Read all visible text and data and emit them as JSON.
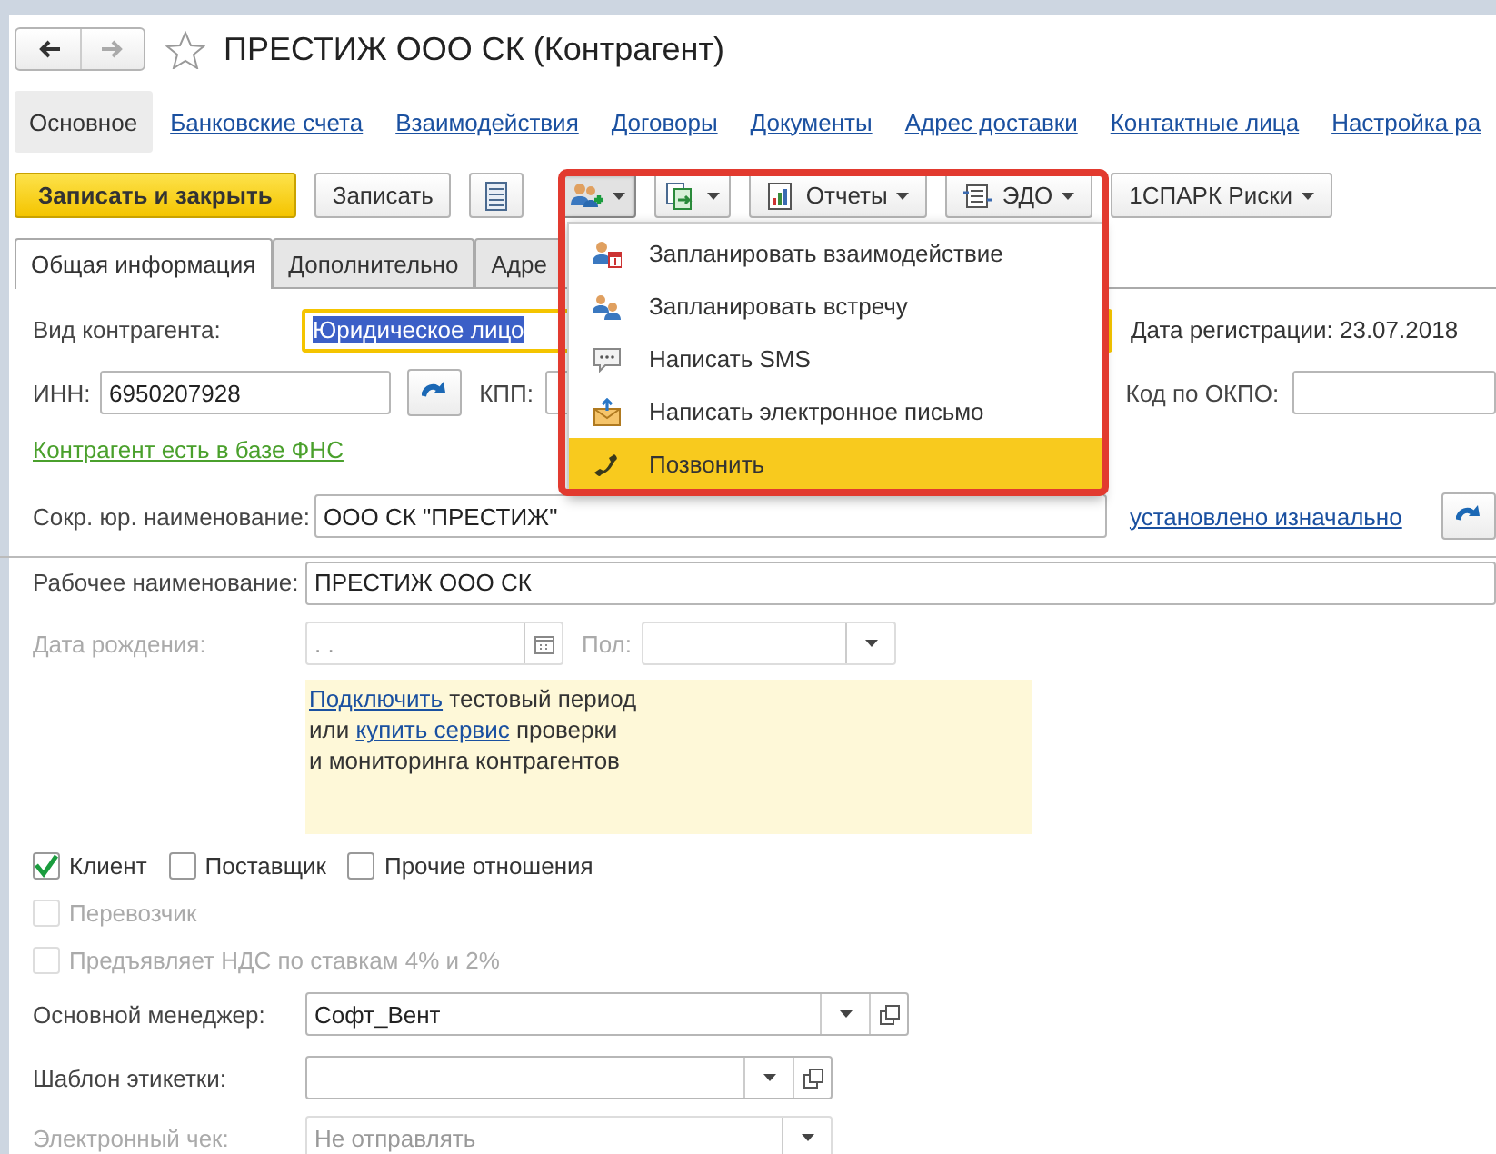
{
  "window": {
    "title": "ПРЕСТИЖ ООО СК (Контрагент)",
    "favorite": false
  },
  "sections": [
    {
      "label": "Основное",
      "selected": true
    },
    {
      "label": "Банковские счета",
      "selected": false
    },
    {
      "label": "Взаимодействия",
      "selected": false
    },
    {
      "label": "Договоры",
      "selected": false
    },
    {
      "label": "Документы",
      "selected": false
    },
    {
      "label": "Адрес доставки",
      "selected": false
    },
    {
      "label": "Контактные лица",
      "selected": false
    },
    {
      "label": "Настройка ра",
      "selected": false
    }
  ],
  "toolbar": [
    {
      "kind": "primary",
      "label": "Записать и закрыть"
    },
    {
      "kind": "plain",
      "label": "Записать"
    },
    {
      "kind": "list"
    },
    {
      "kind": "interactions",
      "expanded": true
    },
    {
      "kind": "create",
      "expanded": false
    },
    {
      "kind": "reports",
      "label": "Отчеты",
      "expanded": false
    },
    {
      "kind": "edo",
      "label": "ЭДО",
      "expanded": false
    },
    {
      "kind": "spark",
      "label": "1СПАРК Риски",
      "expanded": false
    }
  ],
  "menu": [
    {
      "kind": "task",
      "label": "Запланировать взаимодействие",
      "selected": false
    },
    {
      "kind": "meeting",
      "label": "Запланировать встречу",
      "selected": false
    },
    {
      "kind": "sms",
      "label": "Написать SMS",
      "selected": false
    },
    {
      "kind": "email",
      "label": "Написать электронное письмо",
      "selected": false
    },
    {
      "kind": "call",
      "label": "Позвонить",
      "selected": true
    }
  ],
  "tabs": [
    {
      "label": "Общая информация",
      "selected": true
    },
    {
      "label": "Дополнительно",
      "selected": false
    },
    {
      "label": "Адре",
      "selected": false
    }
  ],
  "form": {
    "counterparty_type": {
      "label": "Вид контрагента:",
      "value": "Юридическое лицо",
      "focused": true
    },
    "registration_date": {
      "label": "Дата регистрации:",
      "value": "23.07.2018"
    },
    "inn": {
      "label": "ИНН:",
      "value": "6950207928"
    },
    "kpp": {
      "label": "КПП:"
    },
    "okpo": {
      "label": "Код по ОКПО:"
    },
    "fns_link": "Контрагент есть в базе ФНС",
    "short_name": {
      "label": "Сокр. юр. наименование:",
      "value": "ООО СК \"ПРЕСТИЖ\"",
      "source_link": "установлено изначально"
    },
    "work_name": {
      "label": "Рабочее наименование:",
      "value": "ПРЕСТИЖ ООО СК"
    },
    "birth_date": {
      "label": "Дата рождения:",
      "value": ". .",
      "disabled": true
    },
    "gender": {
      "label": "Пол:",
      "disabled": true
    },
    "notice": [
      [
        {
          "kind": "link",
          "text": "Подключить"
        },
        {
          "kind": "text",
          "text": "тестовый период"
        }
      ],
      [
        {
          "kind": "text",
          "text": "или"
        },
        {
          "kind": "link",
          "text": "купить сервис"
        },
        {
          "kind": "text",
          "text": "проверки"
        }
      ],
      [
        {
          "kind": "text",
          "text": "и мониторинга контрагентов"
        }
      ]
    ],
    "relations": [
      {
        "label": "Клиент",
        "checked": true,
        "disabled": false
      },
      {
        "label": "Поставщик",
        "checked": false,
        "disabled": false
      },
      {
        "label": "Прочие отношения",
        "checked": false,
        "disabled": false
      }
    ],
    "flags": [
      {
        "label": "Перевозчик",
        "checked": false,
        "disabled": true
      },
      {
        "label": "Предъявляет НДС по ставкам 4% и 2%",
        "checked": false,
        "disabled": true
      }
    ],
    "manager": {
      "label": "Основной менеджер:",
      "value": "Софт_Вент",
      "disabled": false
    },
    "label_template": {
      "label": "Шаблон этикетки:",
      "disabled": false
    },
    "e_receipt": {
      "label": "Электронный чек:",
      "value": "Не отправлять",
      "disabled": true
    }
  }
}
